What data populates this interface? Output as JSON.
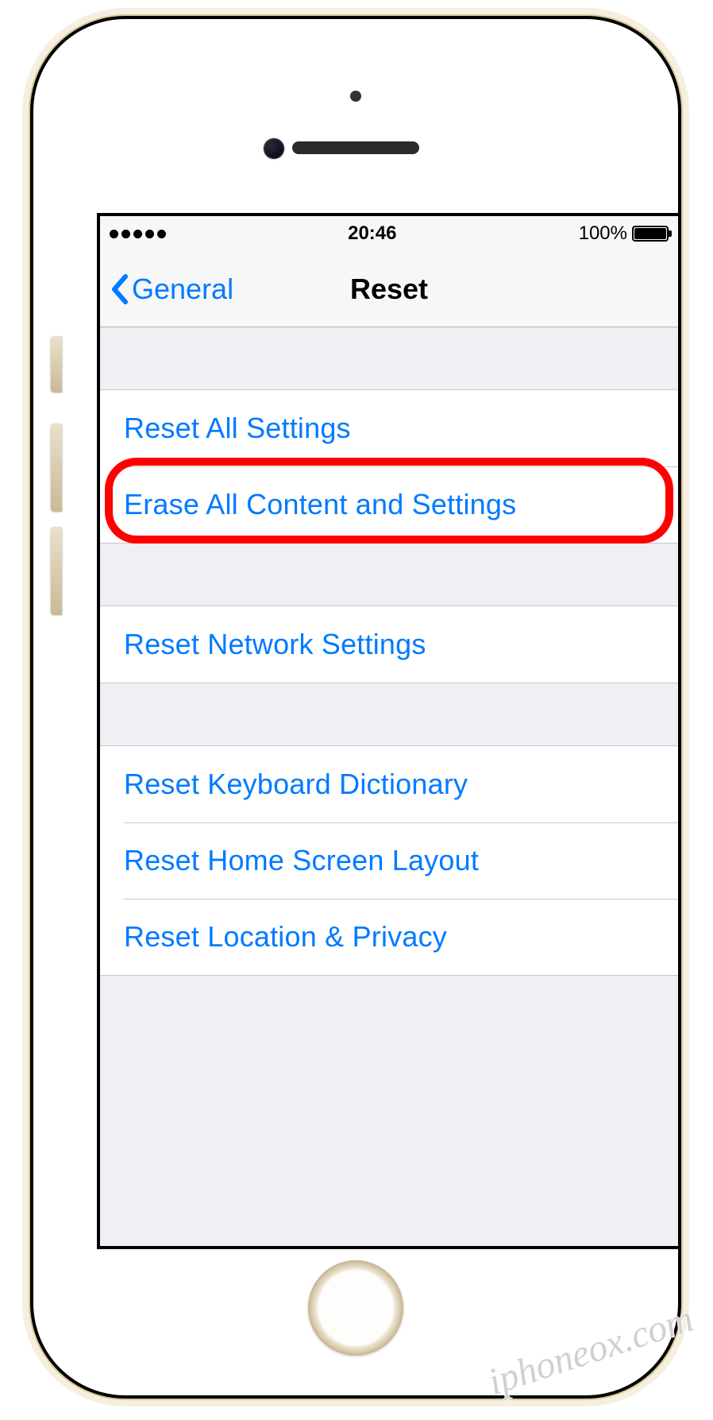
{
  "status": {
    "time": "20:46",
    "battery_pct": "100%"
  },
  "nav": {
    "back_label": "General",
    "title": "Reset"
  },
  "rows": {
    "reset_all": "Reset All Settings",
    "erase_all": "Erase All Content and Settings",
    "reset_network": "Reset Network Settings",
    "reset_keyboard": "Reset Keyboard Dictionary",
    "reset_home": "Reset Home Screen Layout",
    "reset_location": "Reset Location & Privacy"
  },
  "highlighted_row": "erase_all",
  "watermark": "iphoneox.com"
}
